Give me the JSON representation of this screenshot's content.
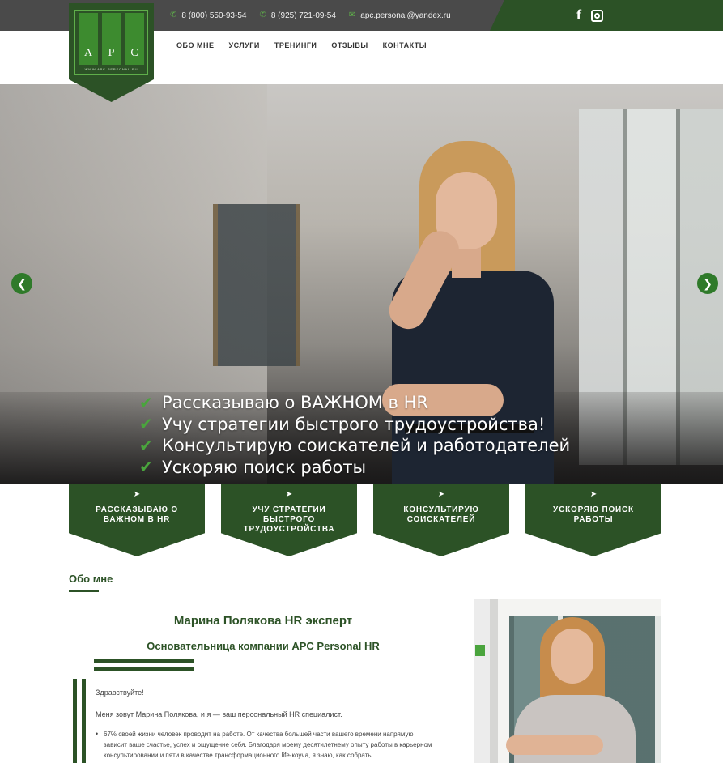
{
  "topbar": {
    "contacts": [
      {
        "icon": "phone-icon",
        "text": "8 (800) 550-93-54"
      },
      {
        "icon": "phone-icon",
        "text": "8 (925) 721-09-54"
      },
      {
        "icon": "mail-icon",
        "text": "apc.personal@yandex.ru"
      }
    ],
    "social": [
      "facebook-icon",
      "instagram-icon"
    ]
  },
  "logo": {
    "letters": [
      "A",
      "P",
      "C"
    ],
    "url": "WWW.APC-PERSONAL.RU"
  },
  "nav": {
    "items": [
      "ОБО МНЕ",
      "УСЛУГИ",
      "ТРЕНИНГИ",
      "ОТЗЫВЫ",
      "КОНТАКТЫ"
    ]
  },
  "hero": {
    "slogans": [
      "Рассказываю о ВАЖНОМ в HR",
      "Учу стратегии быстрого трудоустройства!",
      "Консультирую соискателей и работодателей",
      "Ускоряю поиск работы"
    ],
    "prev_icon": "chevron-left-icon",
    "next_icon": "chevron-right-icon"
  },
  "features": [
    "РАССКАЗЫВАЮ О ВАЖНОМ В HR",
    "УЧУ СТРАТЕГИИ БЫСТРОГО ТРУДОУСТРОЙСТВА",
    "КОНСУЛЬТИРУЮ СОИСКАТЕЛЕЙ",
    "УСКОРЯЮ ПОИСК РАБОТЫ"
  ],
  "about": {
    "title": "Обо мне",
    "name": "Марина Полякова HR эксперт",
    "subtitle": "Основательница компании APC Personal HR",
    "greeting": "Здравствуйте!",
    "intro": "Меня зовут Марина Полякова, и я — ваш персональный HR специалист.",
    "bullet": "67% своей жизни человек проводит на работе. От качества большей части вашего времени напрямую зависит ваше счастье, успех и ощущение себя. Благодаря моему десятилетнему опыту работы в карьерном консультировании и пяти в качестве трансформационного life-коуча, я знаю, как собрать"
  },
  "colors": {
    "brand_green": "#2c5226",
    "accent_green": "#4aa43d",
    "topbar_gray": "#4a4a4a"
  }
}
